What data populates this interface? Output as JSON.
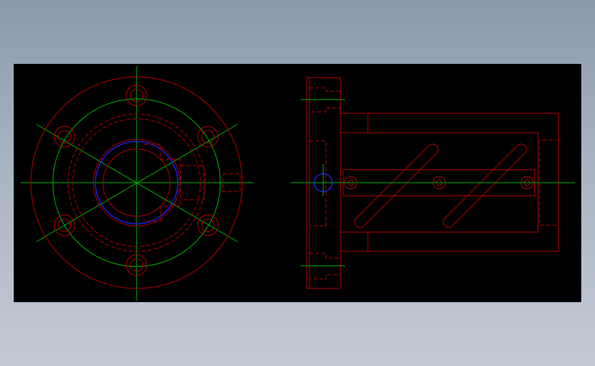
{
  "viewer": {
    "background_color": "#000000",
    "frame_gradient": [
      "#8a99ab",
      "#c3cad6"
    ]
  },
  "drawing": {
    "layers": {
      "outline": "#c00000",
      "centerline": "#00c000",
      "highlight": "#2020e0"
    },
    "views": [
      {
        "name": "front-view",
        "description_hidden": false
      },
      {
        "name": "side-view",
        "description_hidden": false
      }
    ]
  }
}
